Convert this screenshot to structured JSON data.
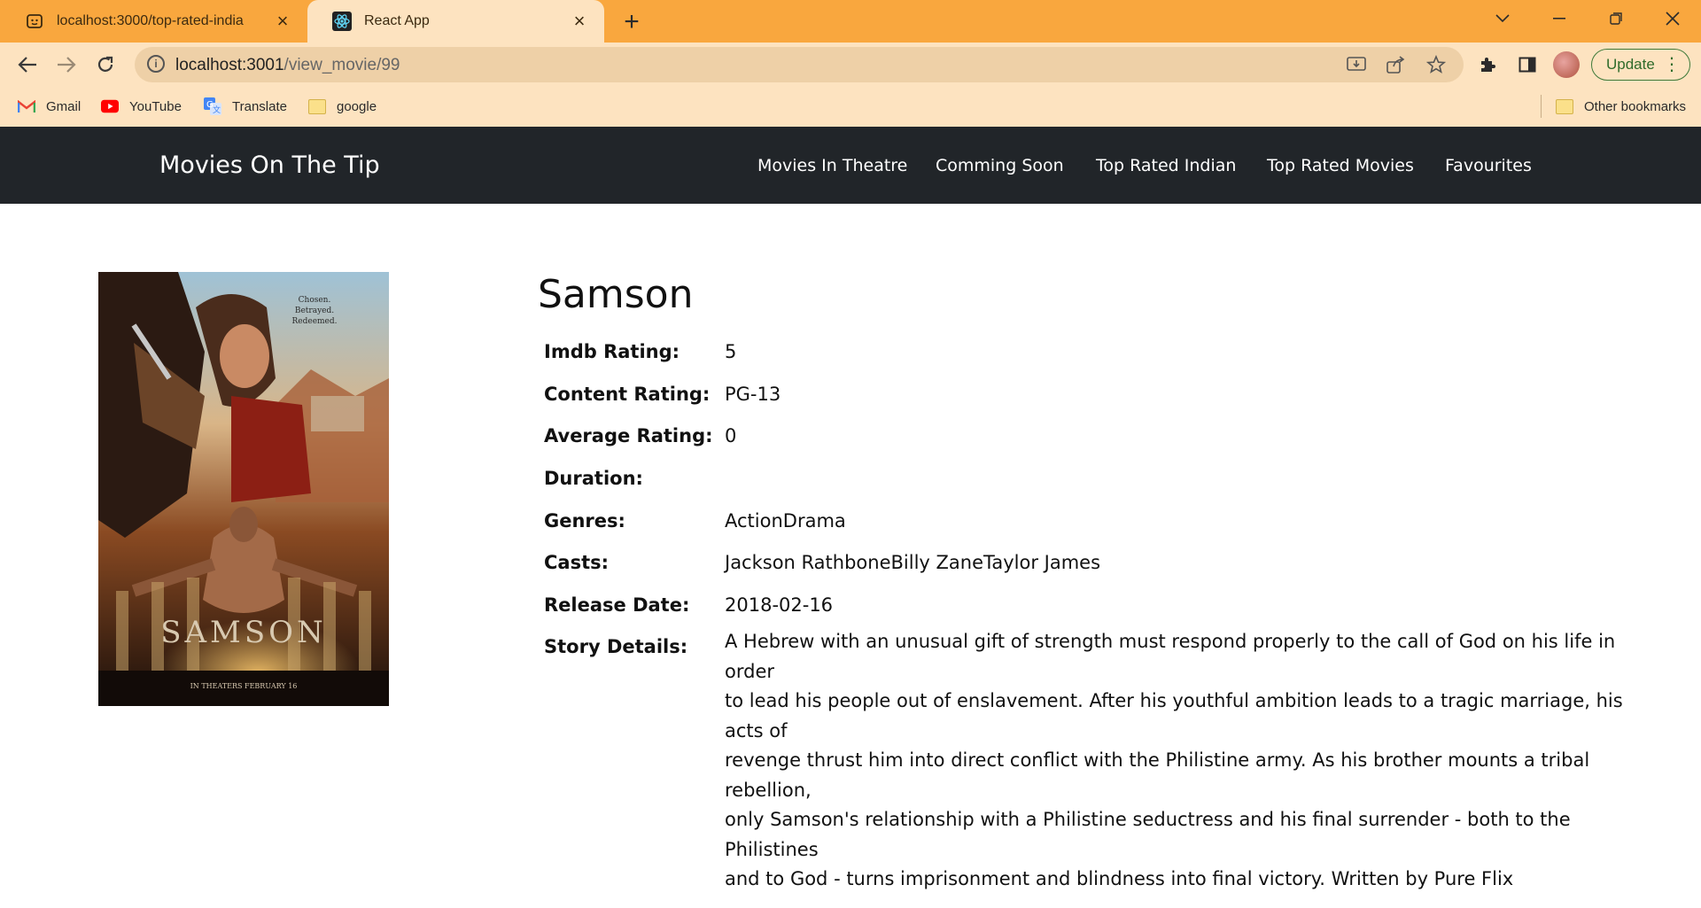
{
  "browser": {
    "tabs": [
      {
        "title": "localhost:3000/top-rated-india",
        "active": false
      },
      {
        "title": "React App",
        "active": true
      }
    ],
    "url_host": "localhost:3001",
    "url_path": "/view_movie/99",
    "update_label": "Update",
    "bookmarks": [
      {
        "label": "Gmail",
        "icon": "gmail-icon"
      },
      {
        "label": "YouTube",
        "icon": "youtube-icon"
      },
      {
        "label": "Translate",
        "icon": "translate-icon"
      },
      {
        "label": "google",
        "icon": "folder-icon"
      }
    ],
    "other_bookmarks": "Other bookmarks",
    "colors": {
      "tabstrip": "#f9a73e",
      "toolbar": "#fde3c0"
    }
  },
  "app": {
    "brand": "Movies On The Tip",
    "nav": [
      "Movies In Theatre",
      "Comming Soon",
      "Top Rated Indian",
      "Top Rated Movies",
      "Favourites"
    ],
    "colors": {
      "navbar": "#212529"
    }
  },
  "movie": {
    "title": "Samson",
    "poster": {
      "tagline": [
        "Chosen.",
        "Betrayed.",
        "Redeemed."
      ],
      "title": "SAMSON",
      "footer": "IN THEATERS FEBRUARY 16"
    },
    "details": [
      {
        "label": "Imdb Rating:",
        "value": "5"
      },
      {
        "label": "Content Rating:",
        "value": "PG-13"
      },
      {
        "label": "Average Rating:",
        "value": "0"
      },
      {
        "label": "Duration:",
        "value": ""
      },
      {
        "label": "Genres:",
        "value": "ActionDrama"
      },
      {
        "label": "Casts:",
        "value": "Jackson RathboneBilly ZaneTaylor James"
      },
      {
        "label": "Release Date:",
        "value": "2018-02-16"
      }
    ],
    "story_label": "Story Details:",
    "story_lines": [
      "A Hebrew with an unusual gift of strength must respond properly to the call of God on his life in order",
      "to lead his people out of enslavement. After his youthful ambition leads to a tragic marriage, his acts of",
      "revenge thrust him into direct conflict with the Philistine army. As his brother mounts a tribal rebellion,",
      "only Samson's relationship with a Philistine seductress and his final surrender - both to the Philistines",
      "and to God - turns imprisonment and blindness into final victory. Written by Pure Flix"
    ]
  }
}
